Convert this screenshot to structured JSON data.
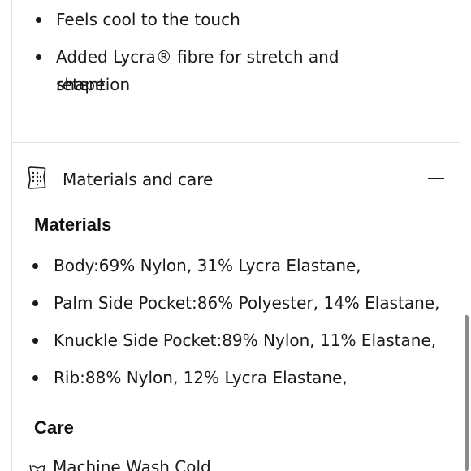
{
  "features": {
    "items": [
      {
        "text": "Feels cool to the touch"
      },
      {
        "text_line1": "Added Lycra® fibre for stretch and shape",
        "text_line2": "retention"
      }
    ]
  },
  "accordion": {
    "title": "Materials and care",
    "icon": "fabric-tag-icon",
    "state": "expanded",
    "toggle_icon": "minus-icon"
  },
  "materials": {
    "heading": "Materials",
    "items": [
      "Body:69% Nylon, 31% Lycra Elastane,",
      "Palm Side Pocket:86% Polyester, 14% Elastane,",
      "Knuckle Side Pocket:89% Nylon, 11% Elastane,",
      "Rib:88% Nylon, 12% Lycra Elastane,"
    ]
  },
  "care": {
    "heading": "Care",
    "items": [
      {
        "icon": "machine-wash-icon",
        "text": "Machine Wash Cold"
      }
    ]
  },
  "colors": {
    "text": "#1a1a1a",
    "divider": "#e2e2e2",
    "scrollbar": "#8a8a8a"
  }
}
